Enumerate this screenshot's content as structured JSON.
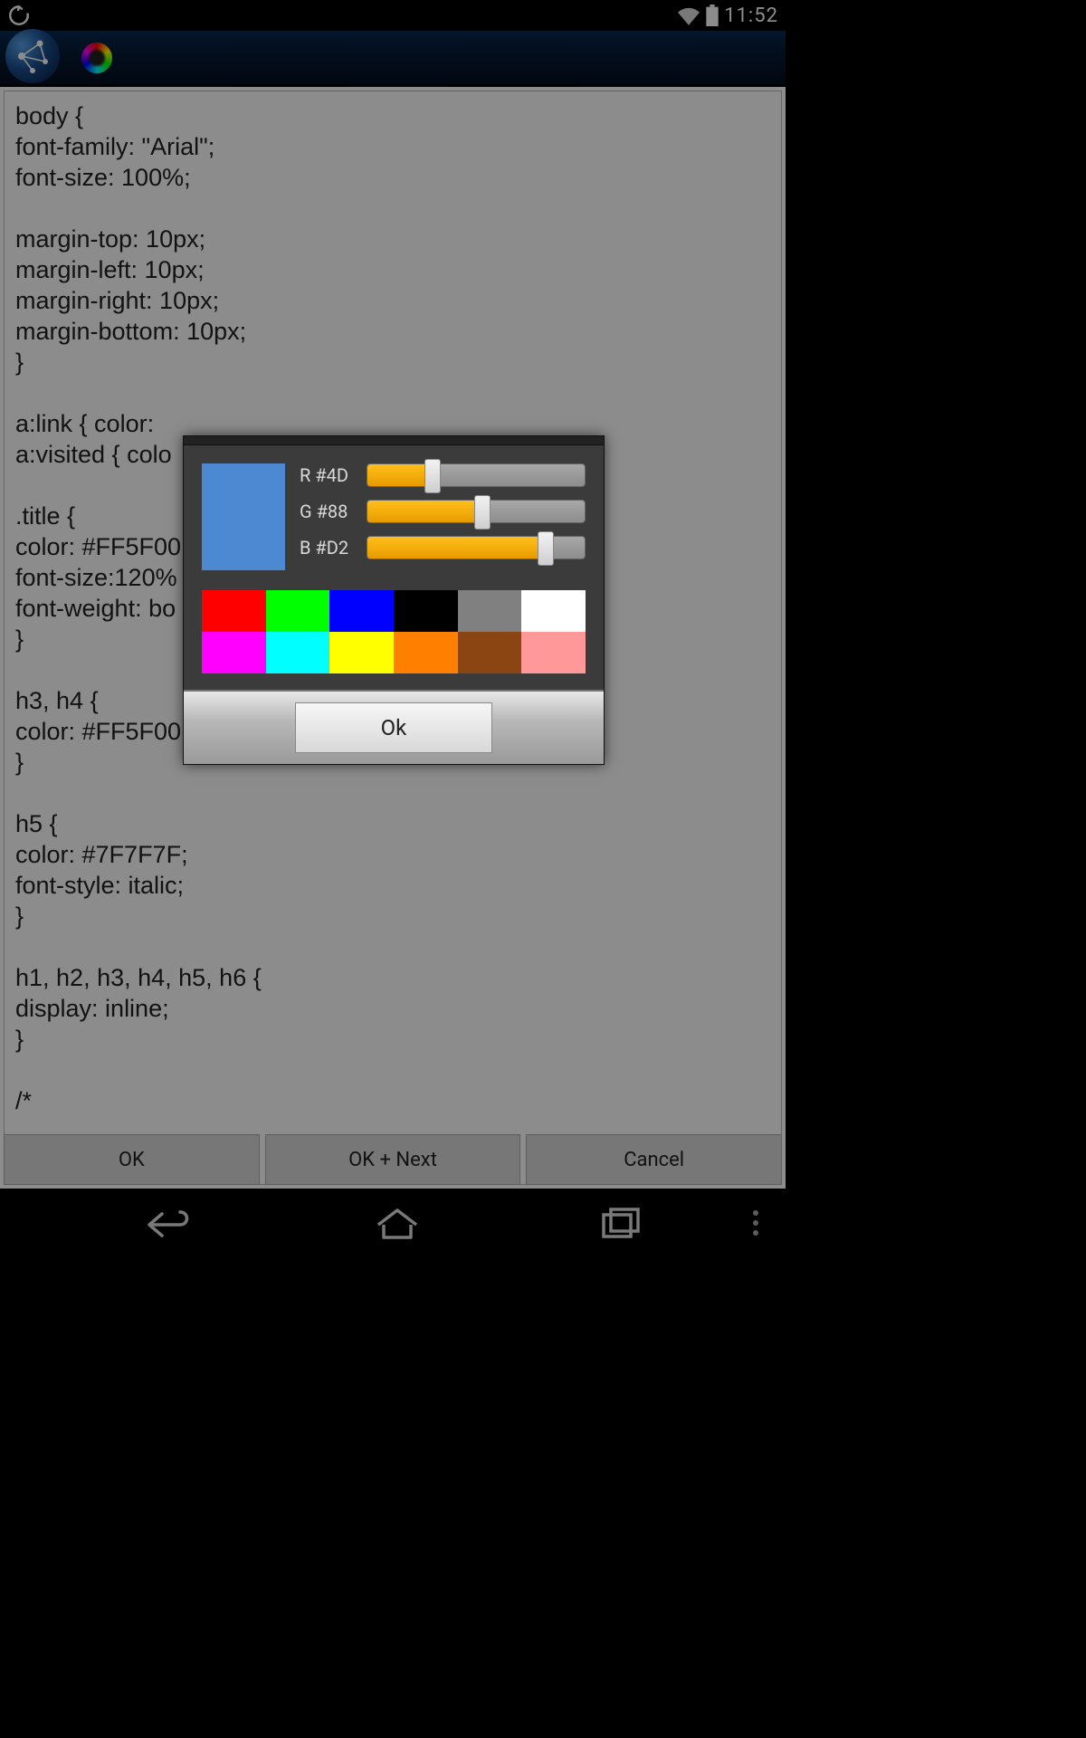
{
  "status": {
    "time": "11:52"
  },
  "editor": {
    "text": "body {\nfont-family: \"Arial\";\nfont-size: 100%;\n\nmargin-top: 10px;\nmargin-left: 10px;\nmargin-right: 10px;\nmargin-bottom: 10px;\n}\n\na:link { color:  \na:visited { colo\n\n.title {\ncolor: #FF5F00\nfont-size:120%\nfont-weight: bo\n}\n\nh3, h4 {\ncolor: #FF5F00\n}\n\nh5 {\ncolor: #7F7F7F;\nfont-style: italic;\n}\n\nh1, h2, h3, h4, h5, h6 {\ndisplay: inline;\n}\n\n/*",
    "buttons": {
      "ok": "OK",
      "ok_next": "OK + Next",
      "cancel": "Cancel"
    }
  },
  "dialog": {
    "preview_color": "#4D88D2",
    "sliders": {
      "r": {
        "label": "R #4D",
        "pct": 30
      },
      "g": {
        "label": "G #88",
        "pct": 53
      },
      "b": {
        "label": "B #D2",
        "pct": 82
      }
    },
    "swatches": [
      "#FF0000",
      "#00FF00",
      "#0000FF",
      "#000000",
      "#808080",
      "#FFFFFF",
      "#FF00FF",
      "#00FFFF",
      "#FFFF00",
      "#FF8000",
      "#8B4513",
      "#FF9999"
    ],
    "ok_label": "Ok"
  }
}
